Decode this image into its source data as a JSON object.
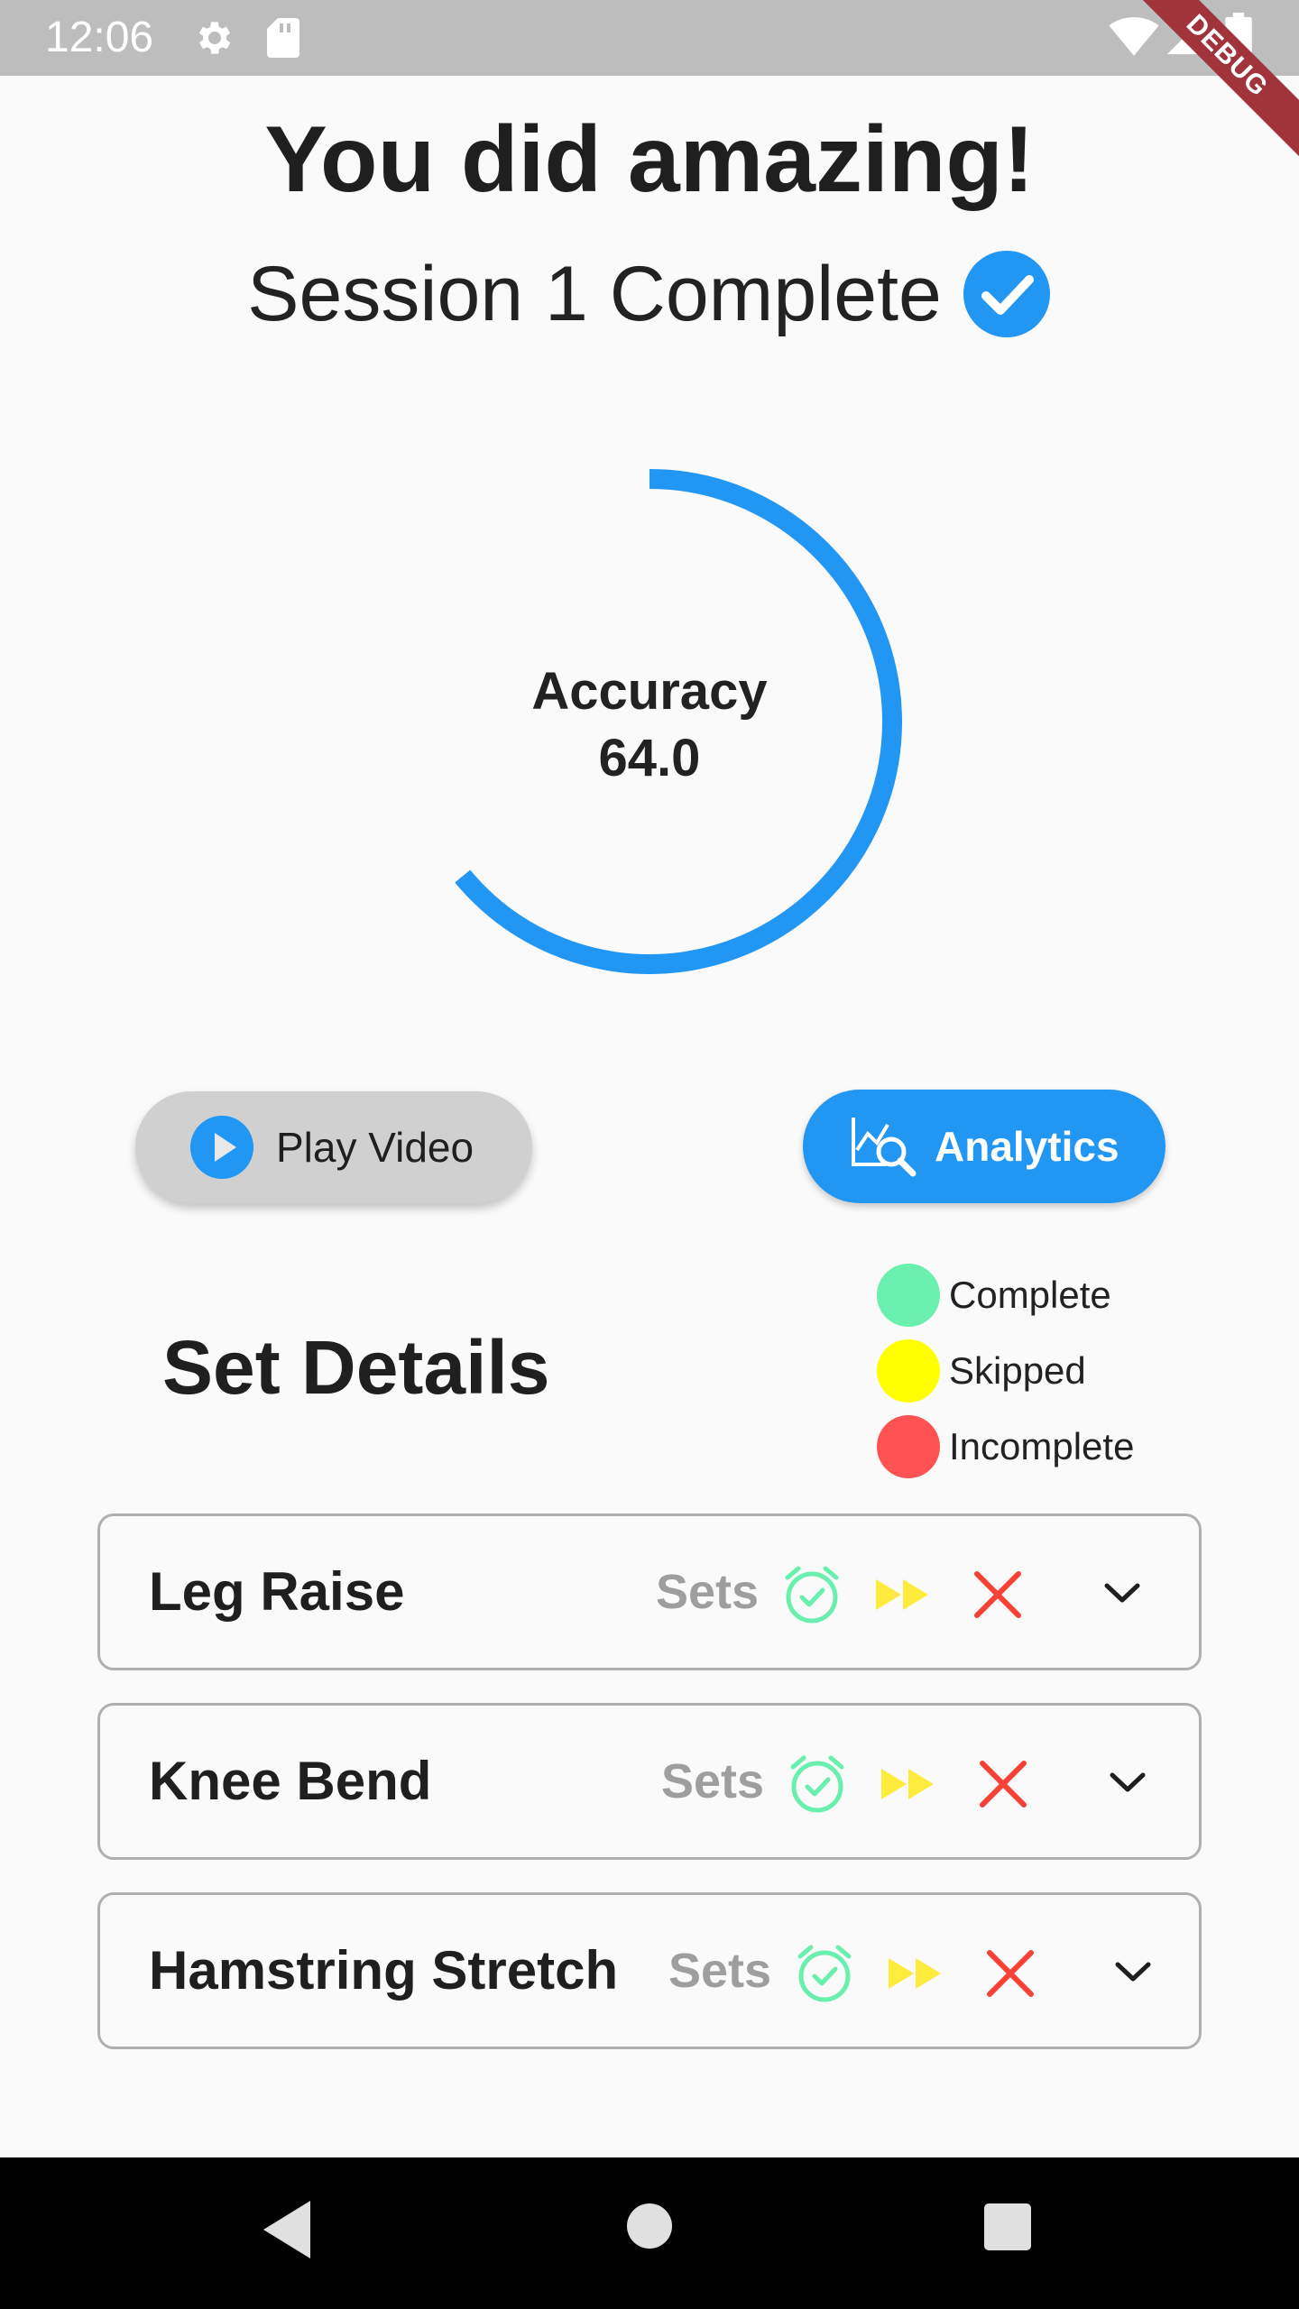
{
  "status_bar": {
    "time": "12:06",
    "debug_label": "DEBUG",
    "icons": [
      "gear-icon",
      "sd-card-icon",
      "wifi-icon",
      "signal-icon",
      "battery-icon"
    ]
  },
  "header": {
    "title": "You did amazing!",
    "session_label": "Session 1 Complete"
  },
  "gauge": {
    "label": "Accuracy",
    "value": "64.0",
    "fraction": 0.64,
    "color": "#2196f3"
  },
  "buttons": {
    "play_video": "Play Video",
    "analytics": "Analytics"
  },
  "set_details": {
    "title": "Set Details",
    "legend": [
      {
        "label": "Complete",
        "color": "#69f0ae"
      },
      {
        "label": "Skipped",
        "color": "#ffff00"
      },
      {
        "label": "Incomplete",
        "color": "#ff5252"
      }
    ],
    "exercises": [
      {
        "name": "Leg Raise",
        "sets_label": "Sets"
      },
      {
        "name": "Knee Bend",
        "sets_label": "Sets"
      },
      {
        "name": "Hamstring Stretch",
        "sets_label": "Sets"
      }
    ]
  },
  "colors": {
    "accent": "#2196f3",
    "complete": "#69f0ae",
    "skipped": "#ffeb3b",
    "incomplete": "#f44336"
  }
}
